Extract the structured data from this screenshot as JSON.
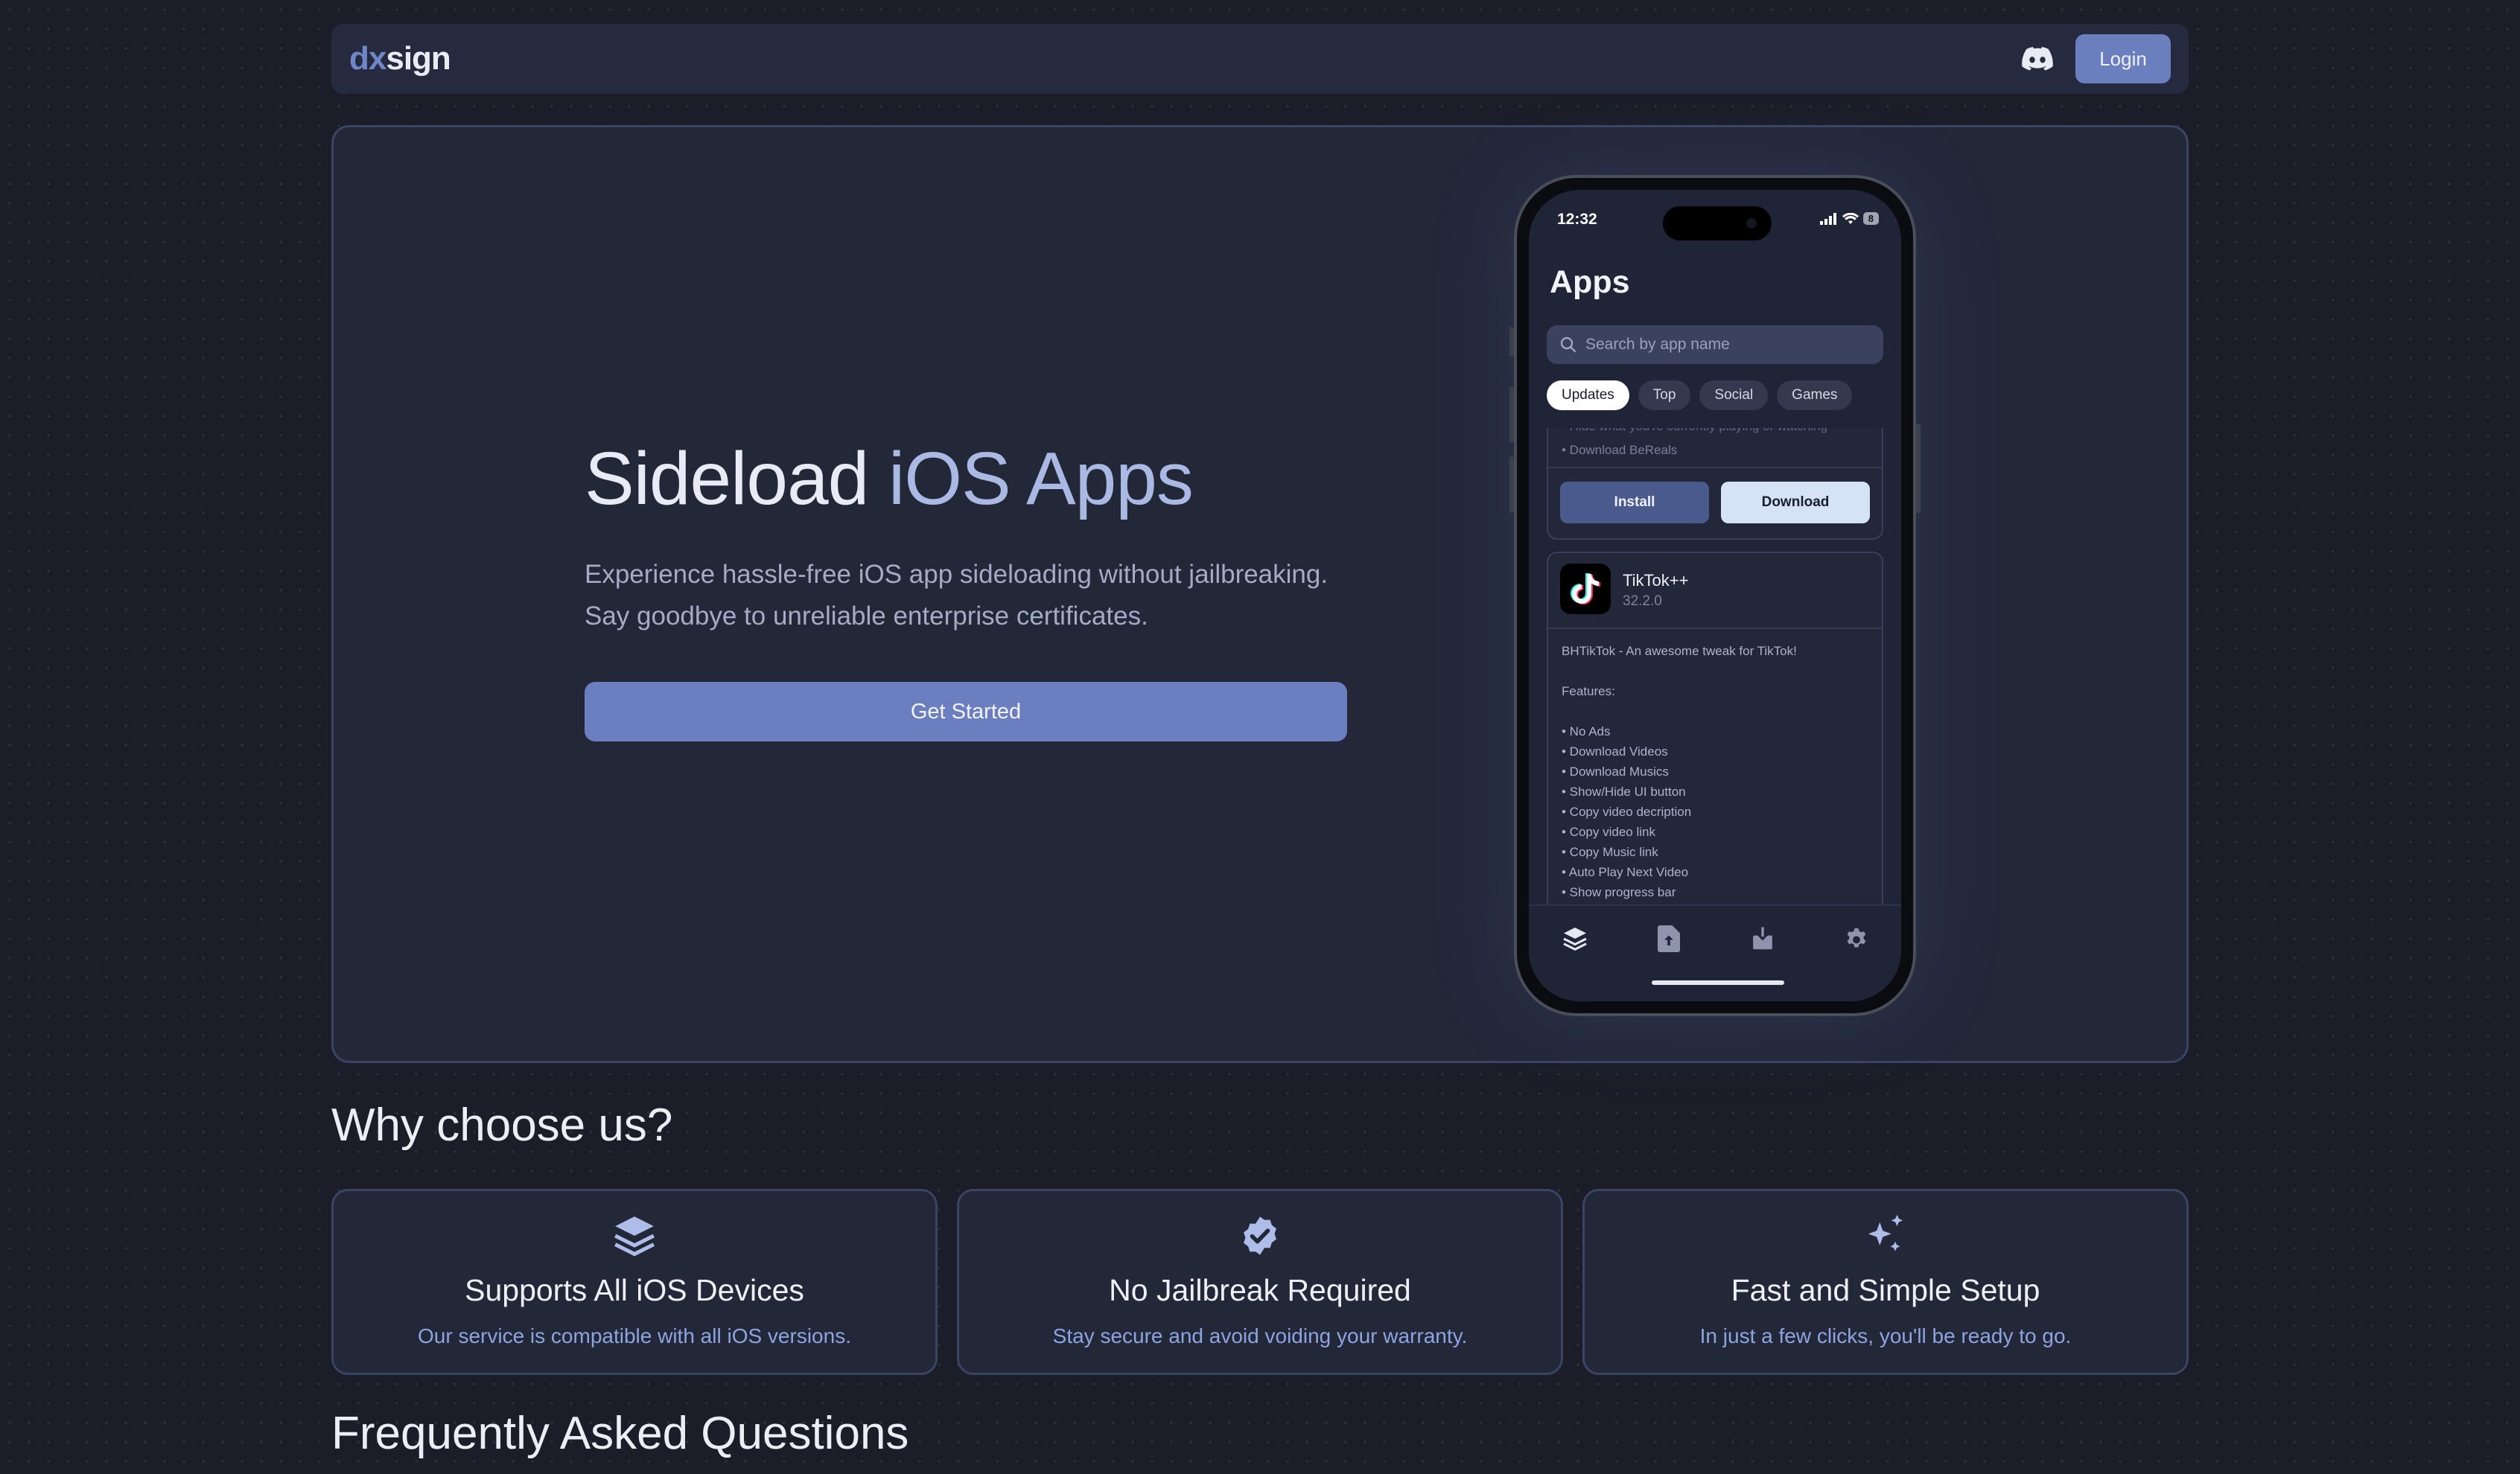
{
  "nav": {
    "logo_prefix": "dx",
    "logo_suffix": "sign",
    "login_label": "Login"
  },
  "hero": {
    "title_main": "Sideload ",
    "title_accent": "iOS Apps",
    "subtitle_line1": "Experience hassle-free iOS app sideloading without jailbreaking.",
    "subtitle_line2": "Say goodbye to unreliable enterprise certificates.",
    "cta_label": "Get Started"
  },
  "phone": {
    "time": "12:32",
    "battery": "8",
    "screen_title": "Apps",
    "search_placeholder": "Search by app name",
    "chips": [
      "Updates",
      "Top",
      "Social",
      "Games"
    ],
    "top_card": {
      "faded_text": "• Hide what you're currently playing or watching",
      "line": "• Download BeReals",
      "install_label": "Install",
      "download_label": "Download"
    },
    "app": {
      "name": "TikTok++",
      "version": "32.2.0",
      "description": "BHTikTok - An awesome tweak for TikTok!",
      "features_heading": "Features:",
      "features": [
        "• No Ads",
        "• Download Videos",
        "• Download Musics",
        "• Show/Hide UI button",
        "• Copy video decription",
        "• Copy video link",
        "• Copy Music link",
        "• Auto Play Next Video",
        "• Show progress bar"
      ]
    }
  },
  "why": {
    "title": "Why choose us?",
    "features": [
      {
        "title": "Supports All iOS Devices",
        "desc": "Our service is compatible with all iOS versions."
      },
      {
        "title": "No Jailbreak Required",
        "desc": "Stay secure and avoid voiding your warranty."
      },
      {
        "title": "Fast and Simple Setup",
        "desc": "In just a few clicks, you'll be ready to go."
      }
    ]
  },
  "faq": {
    "title": "Frequently Asked Questions"
  },
  "colors": {
    "background": "#1b1e29",
    "card": "#232839",
    "accent": "#6b7fbf",
    "accent_light": "#8ea3df"
  }
}
